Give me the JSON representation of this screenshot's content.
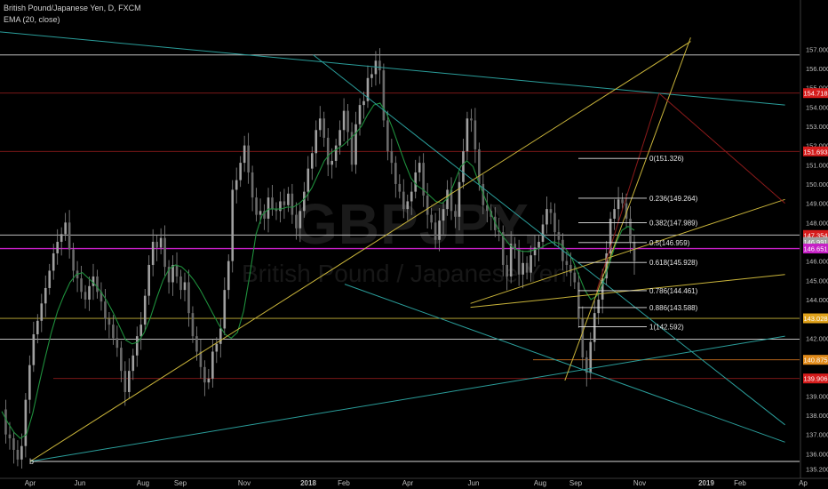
{
  "header": {
    "instrument": "British Pound/Japanese Yen, D, FXCM",
    "indicator": "EMA (20, close)"
  },
  "watermark": {
    "symbol": "GBPJPY,",
    "description": "British Pound / Japanese Yen"
  },
  "colors": {
    "background": "#000000",
    "candle": "#8c8c8c",
    "ema": "#1e8f3c",
    "teal": "#2a9d9a",
    "yellow": "#c9b43a",
    "red_line": "#8b1a1a",
    "white_line": "#d8d8d8",
    "magenta": "#c51fc5",
    "orange": "#c9701d"
  },
  "chart_data": {
    "type": "line",
    "title": "British Pound/Japanese Yen, D, FXCM",
    "xlabel": "",
    "ylabel": "",
    "ylim": [
      135.0,
      157.6
    ],
    "grid": false,
    "x_tick_labels": [
      "Apr",
      "Jun",
      "Aug",
      "Sep",
      "Nov",
      "2018",
      "Feb",
      "Apr",
      "Jun",
      "Aug",
      "Sep",
      "Nov",
      "2019",
      "Feb",
      "Ap"
    ],
    "y_ticks": [
      "157.000",
      "156.000",
      "155.000",
      "154.000",
      "153.000",
      "152.000",
      "151.000",
      "150.000",
      "149.000",
      "148.000",
      "147.000",
      "146.000",
      "145.000",
      "144.000",
      "143.000",
      "142.000",
      "141.000",
      "140.000",
      "139.000",
      "138.000",
      "137.000",
      "136.000",
      "135.200"
    ],
    "price_badges": [
      {
        "label": "154.718",
        "color": "#d61c1c"
      },
      {
        "label": "151.693",
        "color": "#d61c1c"
      },
      {
        "label": "147.354",
        "color": "#d61c1c"
      },
      {
        "label": "146.991",
        "color": "#9e9e9e"
      },
      {
        "label": "146.651",
        "color": "#c51fc5"
      },
      {
        "label": "143.028",
        "color": "#e0a21a"
      },
      {
        "label": "140.875",
        "color": "#e08a1a"
      },
      {
        "label": "139.906",
        "color": "#d61c1c"
      }
    ],
    "fib_levels": [
      {
        "label": "0(151.326)",
        "value": 151.326
      },
      {
        "label": "0.236(149.264)",
        "value": 149.264
      },
      {
        "label": "0.382(147.989)",
        "value": 147.989
      },
      {
        "label": "0.5(146.959)",
        "value": 146.959
      },
      {
        "label": "0.618(145.928)",
        "value": 145.928
      },
      {
        "label": "0.786(144.461)",
        "value": 144.461
      },
      {
        "label": "0.886(143.588)",
        "value": 143.588
      },
      {
        "label": "1(142.592)",
        "value": 142.592
      }
    ],
    "horizontal_levels": [
      {
        "value": 156.7,
        "color": "white"
      },
      {
        "value": 154.718,
        "color": "red"
      },
      {
        "value": 151.693,
        "color": "red"
      },
      {
        "value": 147.354,
        "color": "white"
      },
      {
        "value": 146.651,
        "color": "magenta"
      },
      {
        "value": 143.028,
        "color": "yellow"
      },
      {
        "value": 141.95,
        "color": "white"
      },
      {
        "value": 140.875,
        "color": "orange"
      },
      {
        "value": 139.906,
        "color": "red"
      },
      {
        "value": 135.6,
        "color": "white"
      }
    ],
    "series": [
      {
        "kind": "candles",
        "close_path": [
          138.3,
          137.0,
          136.8,
          136.2,
          135.7,
          136.4,
          138.8,
          140.6,
          142.2,
          142.9,
          143.8,
          144.6,
          145.5,
          146.4,
          147.0,
          147.4,
          148.0,
          146.6,
          145.5,
          145.1,
          144.4,
          144.0,
          144.7,
          145.2,
          144.4,
          143.9,
          143.0,
          142.7,
          142.0,
          141.5,
          140.3,
          139.2,
          140.3,
          141.1,
          142.1,
          142.7,
          144.2,
          145.8,
          147.0,
          146.7,
          147.2,
          145.7,
          144.9,
          145.8,
          145.2,
          144.5,
          144.9,
          143.3,
          142.1,
          141.3,
          140.5,
          139.7,
          139.9,
          141.3,
          141.7,
          142.5,
          144.5,
          146.0,
          149.7,
          150.2,
          151.1,
          152.0,
          150.6,
          149.3,
          148.4,
          148.6,
          148.2,
          149.3,
          148.7,
          148.6,
          149.1,
          148.9,
          149.5,
          148.4,
          147.7,
          148.6,
          149.6,
          150.8,
          151.6,
          152.8,
          153.4,
          152.4,
          151.0,
          151.2,
          152.0,
          152.8,
          153.8,
          152.7,
          151.0,
          153.1,
          154.1,
          154.3,
          155.5,
          155.7,
          156.4,
          155.9,
          153.3,
          151.7,
          151.1,
          150.0,
          149.6,
          148.7,
          149.1,
          149.6,
          150.6,
          151.1,
          149.4,
          148.4,
          148.0,
          147.1,
          148.1,
          148.7,
          149.7,
          148.6,
          148.3,
          150.1,
          151.7,
          153.4,
          153.3,
          151.8,
          150.0,
          148.9,
          148.6,
          148.3,
          147.6,
          147.5,
          145.8,
          145.2,
          146.9,
          146.6,
          145.3,
          145.9,
          145.4,
          146.3,
          146.7,
          147.0,
          147.9,
          148.7,
          148.5,
          147.5,
          147.1,
          146.0,
          145.8,
          145.4,
          144.9,
          143.0,
          141.0,
          140.2,
          141.8,
          143.3,
          144.0,
          145.1,
          146.4,
          148.2,
          148.7,
          149.2,
          149.0,
          148.2,
          147.0,
          146.0
        ]
      },
      {
        "kind": "ema",
        "name": "EMA (20, close)",
        "values": [
          138.2,
          137.6,
          137.1,
          136.8,
          137.0,
          138.1,
          139.6,
          141.0,
          142.3,
          143.4,
          144.2,
          144.9,
          145.3,
          145.4,
          145.1,
          144.8,
          144.4,
          143.9,
          143.3,
          142.6,
          141.9,
          141.7,
          141.8,
          142.3,
          143.1,
          144.1,
          145.0,
          145.6,
          145.8,
          145.7,
          145.4,
          145.0,
          144.5,
          143.9,
          143.3,
          142.7,
          142.2,
          142.0,
          142.3,
          143.4,
          145.3,
          147.4,
          148.4,
          148.7,
          148.7,
          148.7,
          148.8,
          148.8,
          149.0,
          149.3,
          149.8,
          150.5,
          151.2,
          151.6,
          151.8,
          152.0,
          152.3,
          152.6,
          153.0,
          153.6,
          154.1,
          154.2,
          153.7,
          152.9,
          152.0,
          151.1,
          150.3,
          149.9,
          149.7,
          149.4,
          149.1,
          149.0,
          149.3,
          150.1,
          150.9,
          151.2,
          150.9,
          150.0,
          149.2,
          148.4,
          147.7,
          147.2,
          146.8,
          146.6,
          146.5,
          146.5,
          146.6,
          146.7,
          146.9,
          147.0,
          146.9,
          146.6,
          146.1,
          145.3,
          144.5,
          144.0,
          144.2,
          144.9,
          145.9,
          146.9,
          147.6,
          147.8,
          147.6
        ]
      }
    ],
    "trendlines": [
      {
        "color": "teal",
        "from": [
          "2017-03",
          157.9
        ],
        "to": [
          "2019-04",
          154.1
        ]
      },
      {
        "color": "teal",
        "from": [
          "2018-01",
          156.7
        ],
        "to": [
          "2019-04",
          137.5
        ]
      },
      {
        "color": "teal",
        "from": [
          "2017-04",
          135.6
        ],
        "to": [
          "2019-04",
          142.1
        ]
      },
      {
        "color": "teal",
        "from": [
          "2018-02",
          144.8
        ],
        "to": [
          "2019-04",
          136.6
        ]
      },
      {
        "color": "yellow",
        "from": [
          "2017-04",
          135.6
        ],
        "to": [
          "2019-01",
          157.4
        ]
      },
      {
        "color": "yellow",
        "from": [
          "2018-09",
          139.8
        ],
        "to": [
          "2019-01",
          157.6
        ]
      },
      {
        "color": "yellow",
        "from": [
          "2018-06",
          143.8
        ],
        "to": [
          "2019-04",
          149.2
        ]
      },
      {
        "color": "yellow",
        "from": [
          "2018-06",
          143.6
        ],
        "to": [
          "2019-04",
          145.3
        ]
      },
      {
        "color": "red",
        "from": [
          "2018-10",
          144.4
        ],
        "to": [
          "2018-12",
          154.7
        ]
      },
      {
        "color": "red",
        "from": [
          "2018-12",
          154.7
        ],
        "to": [
          "2019-04",
          149.0
        ]
      }
    ]
  },
  "marker": {
    "text": "b"
  }
}
